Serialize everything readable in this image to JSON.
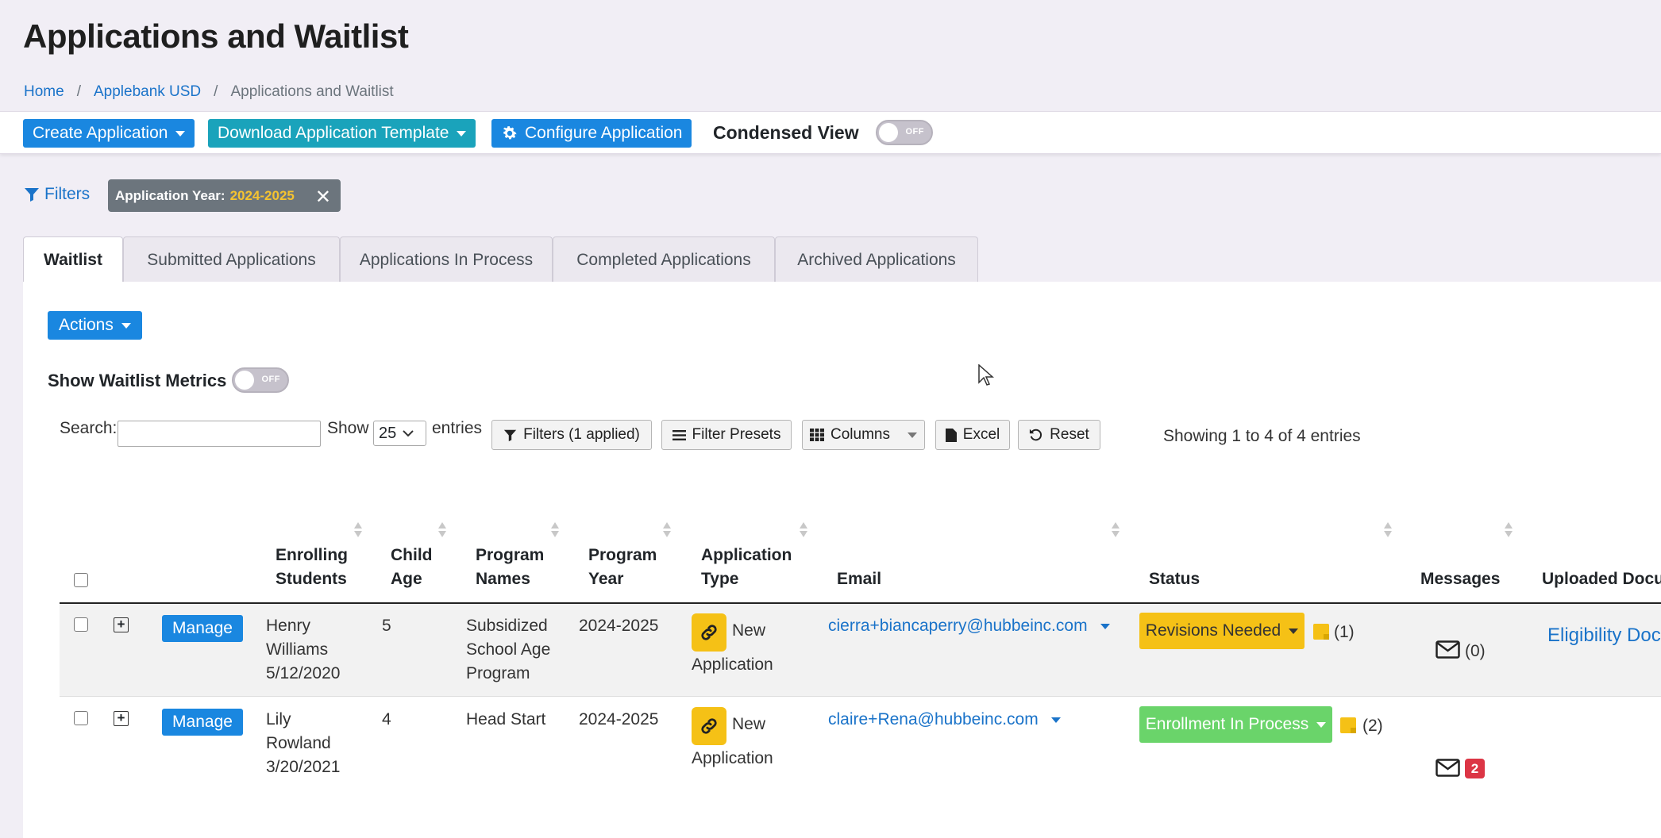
{
  "page": {
    "title": "Applications and Waitlist"
  },
  "breadcrumb": {
    "home": "Home",
    "org": "Applebank USD",
    "current": "Applications and Waitlist",
    "sep": "/"
  },
  "toolbar": {
    "create": "Create Application",
    "download": "Download Application Template",
    "configure": "Configure Application",
    "condensed_label": "Condensed View",
    "condensed_state": "OFF"
  },
  "filters": {
    "label": "Filters",
    "chip_label": "Application Year:",
    "chip_value": "2024-2025"
  },
  "tabs": [
    "Waitlist",
    "Submitted Applications",
    "Applications In Process",
    "Completed Applications",
    "Archived Applications"
  ],
  "waitlist": {
    "actions": "Actions",
    "metrics_label": "Show Waitlist Metrics",
    "metrics_state": "OFF"
  },
  "table_controls": {
    "search_label": "Search:",
    "show_label": "Show",
    "entries_label": "entries",
    "page_length": "25",
    "filters_btn": "Filters (1 applied)",
    "presets_btn": "Filter Presets",
    "columns_btn": "Columns",
    "excel_btn": "Excel",
    "reset_btn": "Reset",
    "info": "Showing 1 to 4 of 4 entries"
  },
  "table": {
    "headers": {
      "students_1": "Enrolling",
      "students_2": "Students",
      "age_1": "Child",
      "age_2": "Age",
      "program_1": "Program",
      "program_2": "Names",
      "year_1": "Program",
      "year_2": "Year",
      "type_1": "Application",
      "type_2": "Type",
      "email": "Email",
      "status": "Status",
      "messages": "Messages",
      "docs": "Uploaded Docu"
    },
    "rows": [
      {
        "manage": "Manage",
        "name_1": "Henry",
        "name_2": "Williams",
        "dob": "5/12/2020",
        "age": "5",
        "program_1": "Subsidized",
        "program_2": "School Age",
        "program_3": "Program",
        "year": "2024-2025",
        "type_1": "New",
        "type_2": "Application",
        "email": "cierra+biancaperry@hubbeinc.com",
        "status": "Revisions Needed",
        "status_color": "#f5c116",
        "notes": "(1)",
        "messages": "(0)",
        "doc": "Eligibility Doc"
      },
      {
        "manage": "Manage",
        "name_1": "Lily",
        "name_2": "Rowland",
        "dob": "3/20/2021",
        "age": "4",
        "program_1": "Head Start",
        "year": "2024-2025",
        "type_1": "New",
        "type_2": "Application",
        "email": "claire+Rena@hubbeinc.com",
        "status": "Enrollment In Process",
        "status_color": "#6ad46a",
        "notes": "(2)",
        "messages_badge": "2"
      }
    ]
  }
}
